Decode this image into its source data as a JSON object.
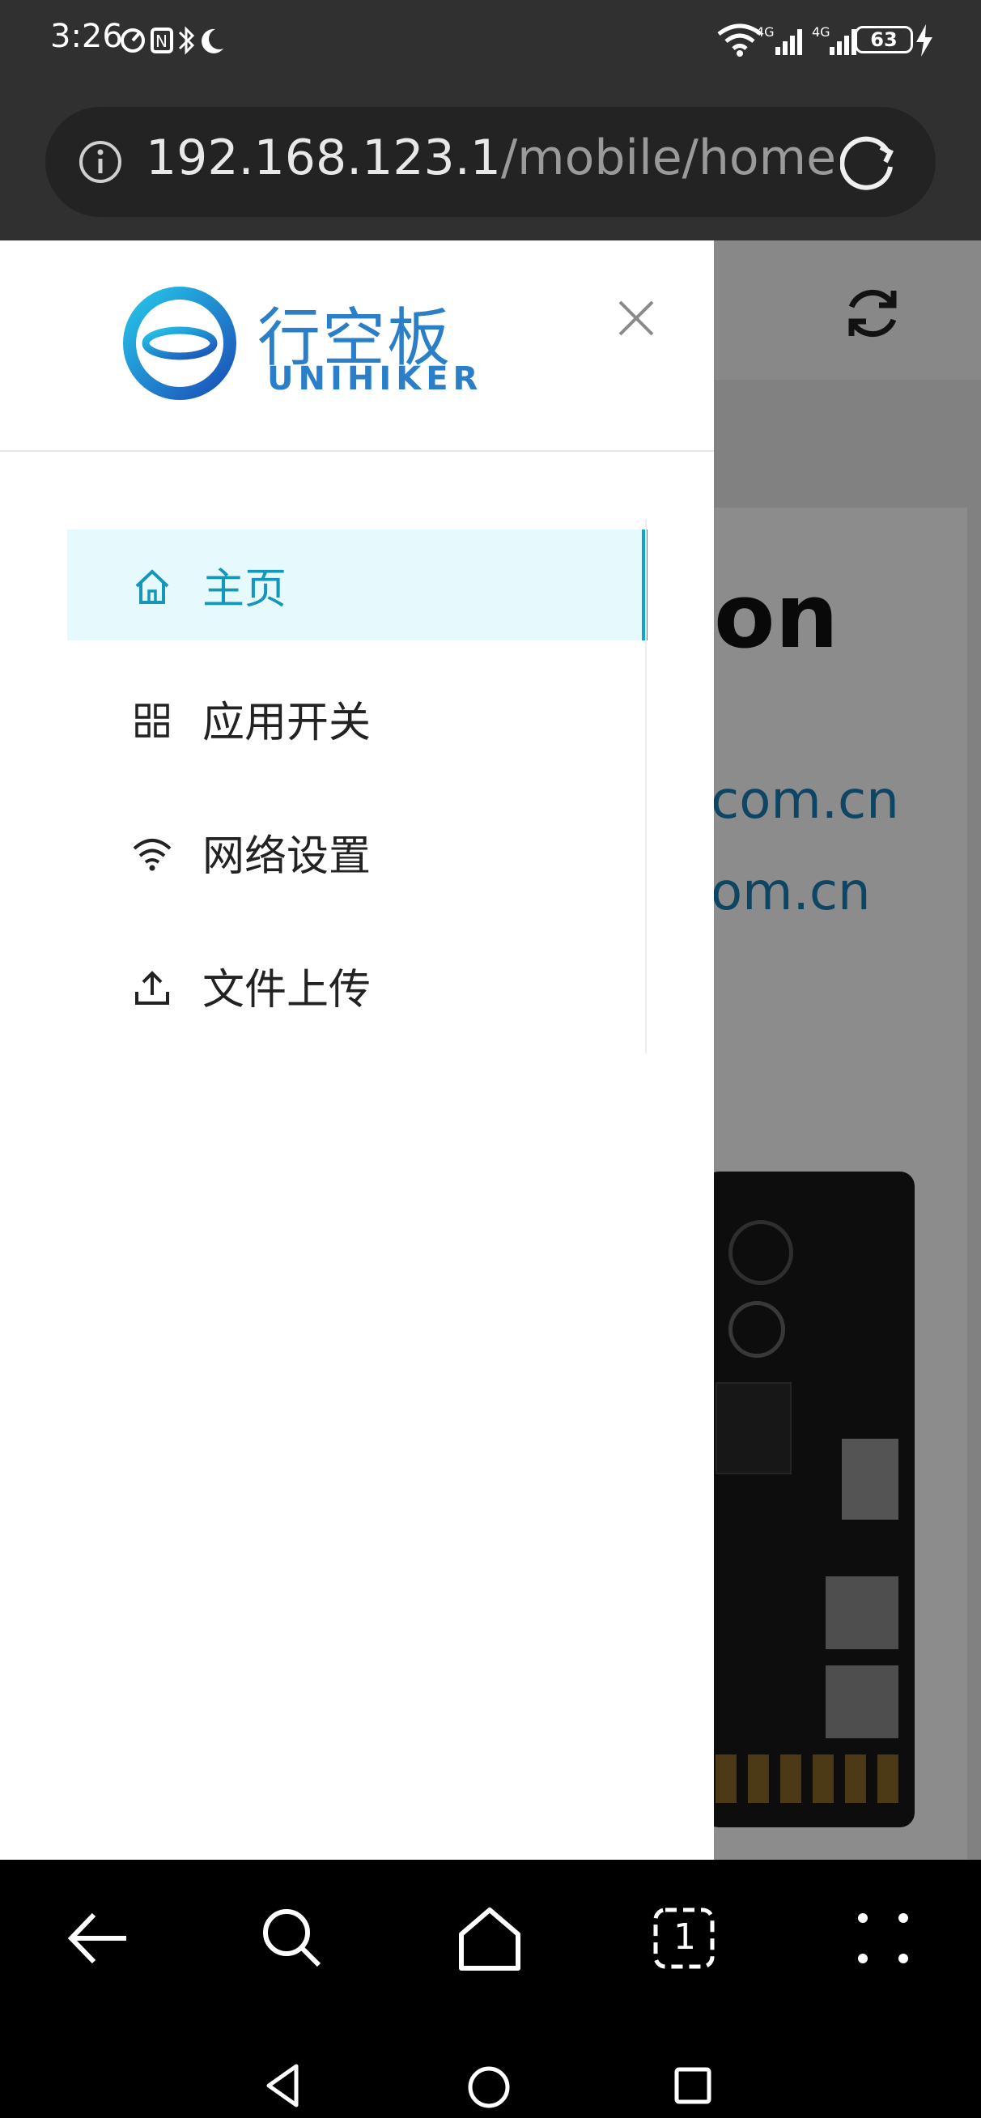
{
  "status_bar": {
    "time": "3:26",
    "battery": "63",
    "network_1": "4G",
    "network_2": "4G"
  },
  "address_bar": {
    "host": "192.168.123.1",
    "path": "/mobile/home"
  },
  "drawer": {
    "logo_brand": "行空板",
    "logo_latin": "UNIHIKER",
    "menu": [
      {
        "label": "主页",
        "icon": "home-icon",
        "active": true
      },
      {
        "label": "应用开关",
        "icon": "grid-icon",
        "active": false
      },
      {
        "label": "网络设置",
        "icon": "wifi-icon",
        "active": false
      },
      {
        "label": "文件上传",
        "icon": "upload-icon",
        "active": false
      }
    ]
  },
  "page_behind": {
    "heading_fragment": "on",
    "link_1_fragment": "com.cn",
    "link_2_fragment": "om.cn"
  },
  "browser_toolbar": {
    "tab_count": "1"
  },
  "colors": {
    "accent": "#10a6c9",
    "active_bg": "#e6fafd",
    "logo": "#2a7fc8"
  }
}
